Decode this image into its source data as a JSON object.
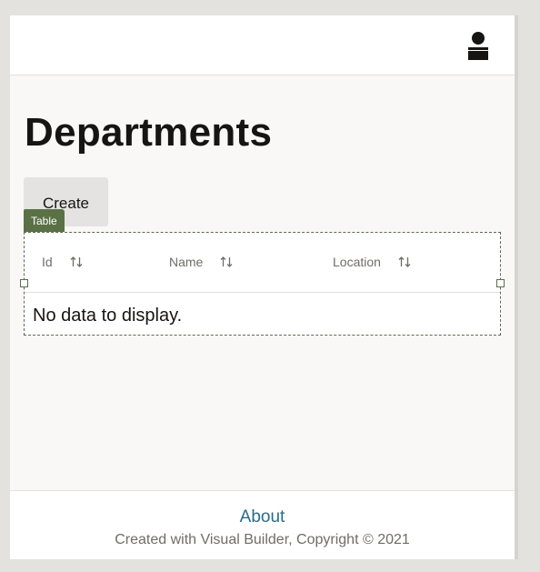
{
  "header": {
    "user_icon": "user-avatar-icon"
  },
  "page": {
    "title": "Departments"
  },
  "toolbar": {
    "create_label": "Create"
  },
  "designer": {
    "table_badge": "Table"
  },
  "table": {
    "columns": [
      {
        "label": "Id",
        "sort_icon": "sort-icon"
      },
      {
        "label": "Name",
        "sort_icon": "sort-icon"
      },
      {
        "label": "Location",
        "sort_icon": "sort-icon"
      }
    ],
    "empty_message": "No data to display."
  },
  "footer": {
    "about_label": "About",
    "copyright": "Created with Visual Builder, Copyright © 2021"
  },
  "colors": {
    "page_bg": "#f9f8f6",
    "badge_green": "#5a7145",
    "link_blue": "#2a6b8a",
    "button_bg": "#e4e3e1"
  }
}
